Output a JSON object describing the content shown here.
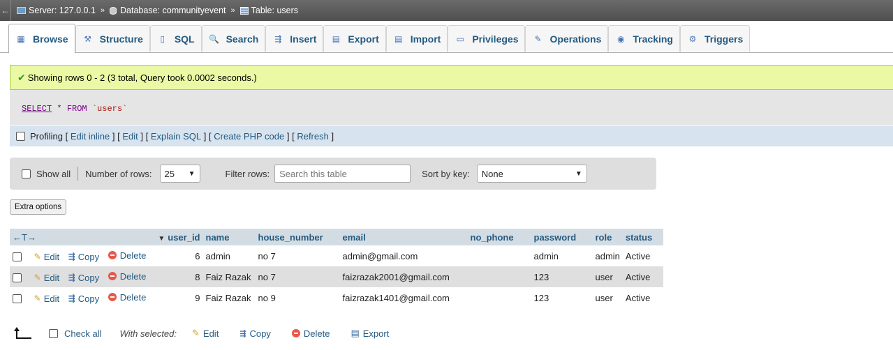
{
  "breadcrumb": {
    "back": "←",
    "server": "Server: 127.0.0.1",
    "database": "Database: communityevent",
    "table": "Table: users",
    "sep": "»"
  },
  "tabs": [
    {
      "label": "Browse",
      "icon": "browse-icon",
      "glyph": "▦"
    },
    {
      "label": "Structure",
      "icon": "structure-icon",
      "glyph": "⚒"
    },
    {
      "label": "SQL",
      "icon": "sql-icon",
      "glyph": "▯"
    },
    {
      "label": "Search",
      "icon": "search-icon",
      "glyph": "🔍"
    },
    {
      "label": "Insert",
      "icon": "insert-icon",
      "glyph": "⇶"
    },
    {
      "label": "Export",
      "icon": "export-icon",
      "glyph": "▤"
    },
    {
      "label": "Import",
      "icon": "import-icon",
      "glyph": "▤"
    },
    {
      "label": "Privileges",
      "icon": "privileges-icon",
      "glyph": "▭"
    },
    {
      "label": "Operations",
      "icon": "operations-icon",
      "glyph": "✎"
    },
    {
      "label": "Tracking",
      "icon": "tracking-icon",
      "glyph": "◉"
    },
    {
      "label": "Triggers",
      "icon": "triggers-icon",
      "glyph": "⚙"
    }
  ],
  "message": "Showing rows 0 - 2 (3 total, Query took 0.0002 seconds.)",
  "sql": {
    "select": "SELECT",
    "star": "*",
    "from": "FROM",
    "table": "`users`"
  },
  "profiling": {
    "label": "Profiling",
    "links": [
      "Edit inline",
      "Edit",
      "Explain SQL",
      "Create PHP code",
      "Refresh"
    ]
  },
  "nav": {
    "show_all": "Show all",
    "rows_label": "Number of rows:",
    "rows_value": "25",
    "filter_label": "Filter rows:",
    "filter_placeholder": "Search this table",
    "sort_label": "Sort by key:",
    "sort_value": "None"
  },
  "extra_options": "Extra options",
  "table": {
    "arrows": "←T→",
    "sort_glyph": "▼",
    "columns": [
      "user_id",
      "name",
      "house_number",
      "email",
      "no_phone",
      "password",
      "role",
      "status"
    ],
    "actions": {
      "edit": "Edit",
      "copy": "Copy",
      "delete": "Delete"
    },
    "rows": [
      {
        "user_id": "6",
        "name": "admin",
        "house_number": "no 7",
        "email": "admin@gmail.com",
        "no_phone": "",
        "password": "admin",
        "role": "admin",
        "status": "Active"
      },
      {
        "user_id": "8",
        "name": "Faiz Razak",
        "house_number": "no 7",
        "email": "faizrazak2001@gmail.com",
        "no_phone": "",
        "password": "123",
        "role": "user",
        "status": "Active"
      },
      {
        "user_id": "9",
        "name": "Faiz Razak",
        "house_number": "no 9",
        "email": "faizrazak1401@gmail.com",
        "no_phone": "",
        "password": "123",
        "role": "user",
        "status": "Active"
      }
    ]
  },
  "bottom": {
    "check_all": "Check all",
    "with_selected": "With selected:",
    "edit": "Edit",
    "copy": "Copy",
    "delete": "Delete",
    "export": "Export"
  }
}
